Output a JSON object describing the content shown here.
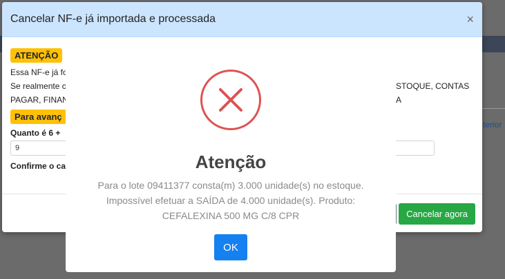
{
  "background": {
    "link_text": "terior"
  },
  "modal": {
    "title": "Cancelar NF-e já importada e processada",
    "close_label": "×",
    "warning_badge": "ATENÇÃO",
    "message_line1": "Essa NF-e já fo",
    "message_line2": "Se realmente c",
    "message_line2_tail": "STOQUE, CONTAS A",
    "message_line3": "PAGAR, FINAN",
    "proceed_badge": "Para avanç",
    "question_label": "Quanto é 6 +",
    "answer_value": "9",
    "confirm_label": "Confirme o ca",
    "cancel_now_button": "Cancelar agora"
  },
  "alert": {
    "icon": "error-x-icon",
    "title": "Atenção",
    "line1": "Para o lote 09411377 consta(m) 3.000 unidade(s) no estoque.",
    "line2": "Impossível efetuar a SAÍDA de 4.000 unidade(s). Produto:",
    "line3": "CEFALEXINA 500 MG C/8 CPR",
    "ok_button": "OK"
  },
  "colors": {
    "header_bg": "#cce5ff",
    "badge_bg": "#ffc107",
    "success": "#28a745",
    "error": "#de5252",
    "primary": "#1581f0"
  }
}
